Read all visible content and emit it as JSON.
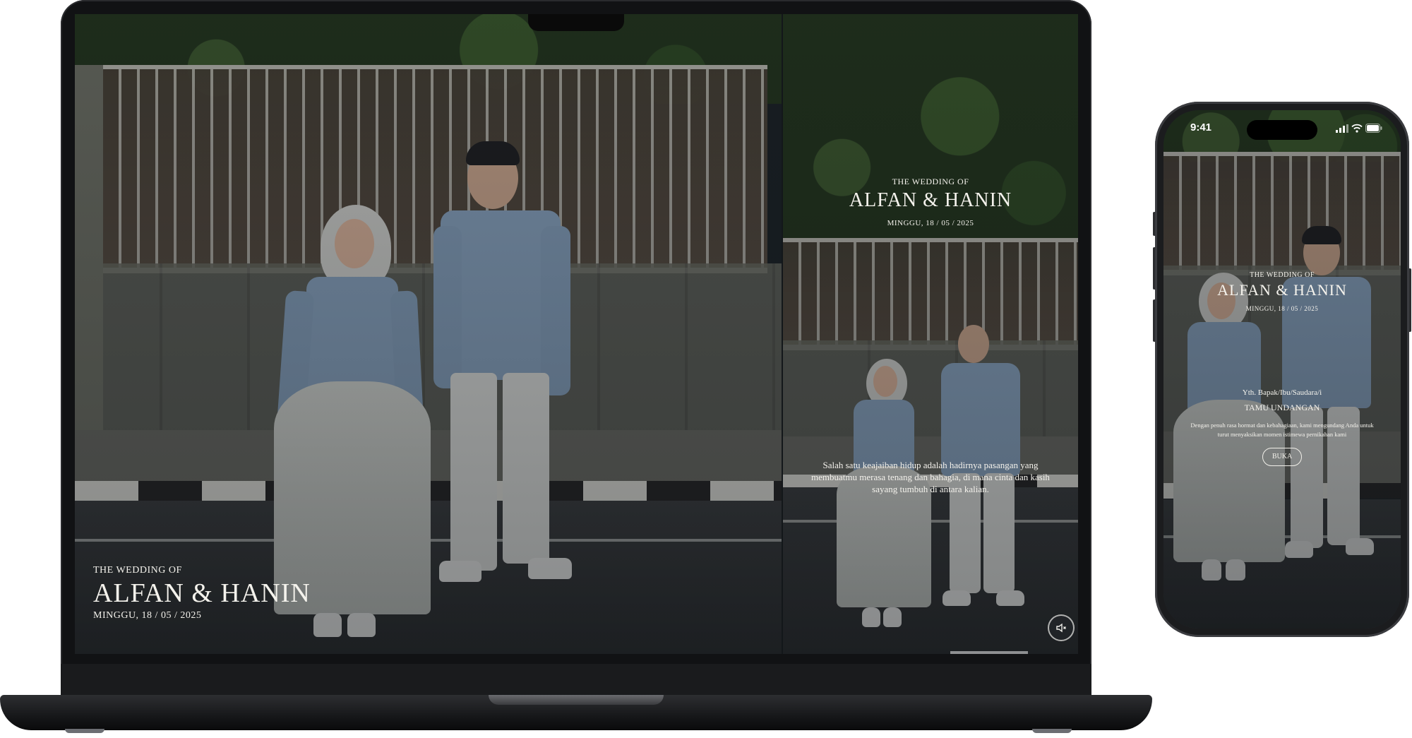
{
  "desktop": {
    "cover": {
      "eyebrow": "THE WEDDING OF",
      "names": "ALFAN & HANIN",
      "date": "MINGGU, 18 / 05 / 2025"
    },
    "side_panel": {
      "eyebrow": "THE WEDDING OF",
      "names": "ALFAN & HANIN",
      "date": "MINGGU, 18 / 05 / 2025",
      "quote": "Salah satu keajaiban hidup adalah hadirnya pasangan yang membuatmu merasa tenang dan bahagia, di mana cinta dan kasih sayang tumbuh di antara kalian."
    },
    "audio_icon": "speaker-muted-icon"
  },
  "phone": {
    "status_bar": {
      "time": "9:41",
      "icons": [
        "signal-icon",
        "wifi-icon",
        "battery-icon"
      ]
    },
    "cover": {
      "eyebrow": "THE WEDDING OF",
      "names": "ALFAN & HANIN",
      "date": "MINGGU, 18 / 05 / 2025",
      "greeting": "Yth. Bapak/Ibu/Saudara/i",
      "guest_name": "TAMU UNDANGAN",
      "message": "Dengan penuh rasa hormat dan kebahagiaan, kami mengundang Anda untuk turut menyaksikan momen istimewa pernikahan kami",
      "open_button": "BUKA"
    }
  },
  "colors": {
    "text_light": "#f4f2ec",
    "shirt_blue": "#8ea9c6",
    "device_dark": "#111214"
  }
}
